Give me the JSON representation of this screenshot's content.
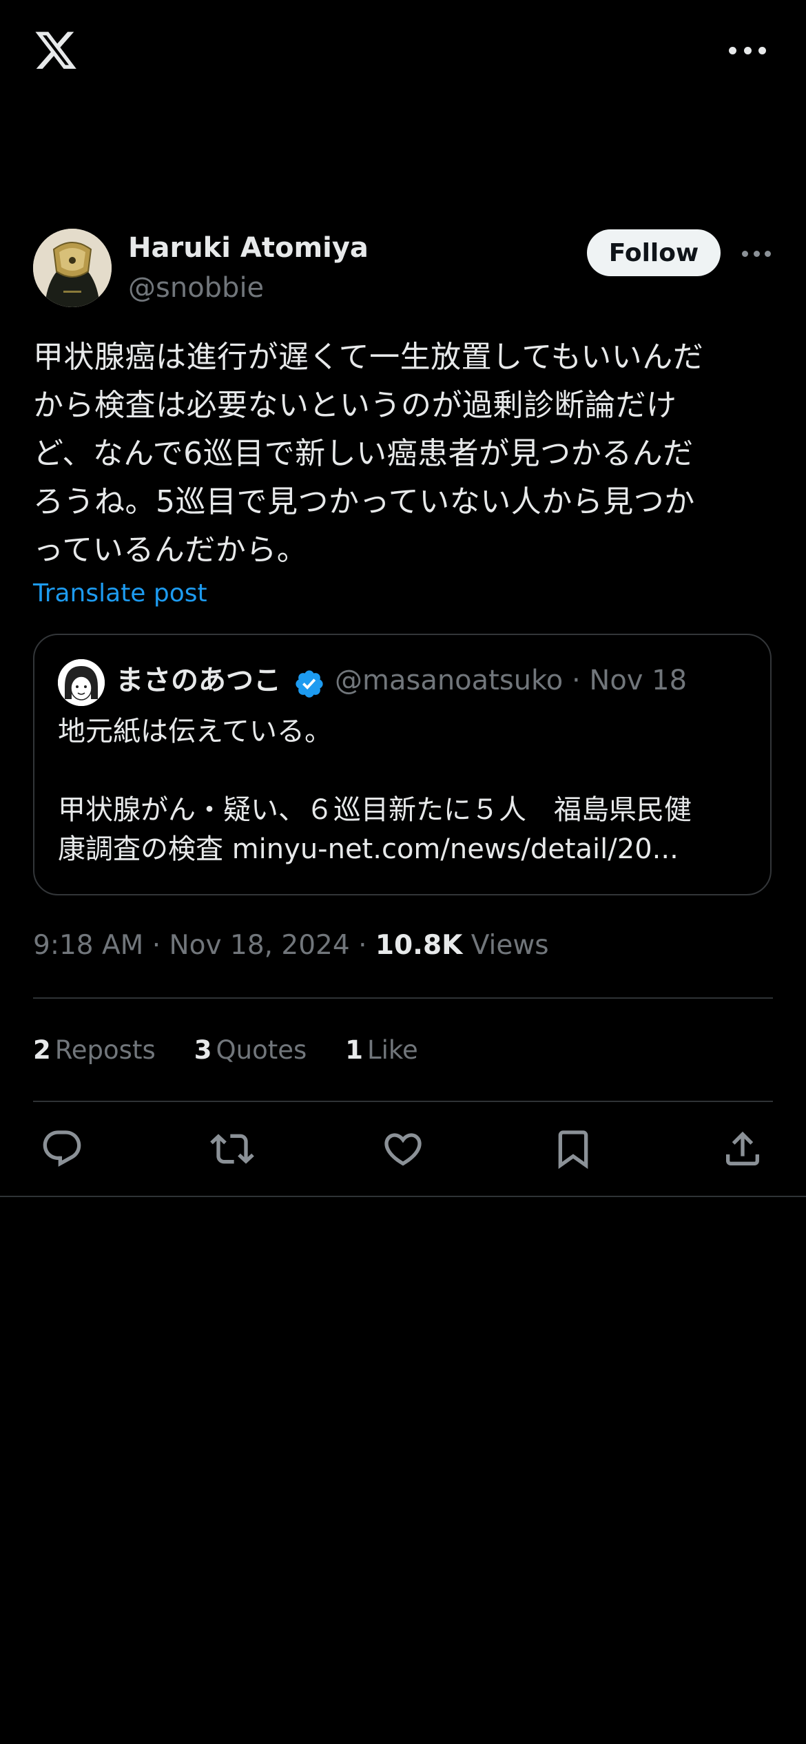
{
  "header": {
    "logo_icon": "x-logo-icon",
    "more_icon": "more-horizontal-icon"
  },
  "tweet": {
    "author": {
      "display_name": "Haruki Atomiya",
      "handle": "@snobbie",
      "avatar_icon": "avatar-image"
    },
    "follow_label": "Follow",
    "text": "甲状腺癌は進行が遅くて一生放置してもいいんだ\nから検査は必要ないというのが過剰診断論だけ\nど、なんで6巡目で新しい癌患者が見つかるんだ\nろうね。5巡目で見つかっていない人から見つか\nっているんだから。",
    "translate_label": "Translate post",
    "quote": {
      "display_name": "まさのあつこ",
      "verified_icon": "verified-badge-icon",
      "meta": "@masanoatsuko · Nov 18",
      "text": "地元紙は伝えている。\n\n甲状腺がん・疑い、６巡目新たに５人　福島県民健\n康調査の検査 minyu-net.com/news/detail/20..."
    },
    "timestamp": "9:18 AM · Nov 18, 2024 · ",
    "views_count": "10.8K",
    "views_label": " Views",
    "stats": {
      "reposts_count": "2",
      "reposts_label": "Reposts",
      "quotes_count": "3",
      "quotes_label": "Quotes",
      "likes_count": "1",
      "likes_label": "Like"
    }
  },
  "actions": [
    "reply-icon",
    "repost-icon",
    "like-icon",
    "bookmark-icon",
    "share-icon"
  ],
  "colors": {
    "background": "#000000",
    "text_primary": "#e7e9ea",
    "text_secondary": "#71767b",
    "accent": "#1d9bf0",
    "border": "#2f3336",
    "follow_bg": "#eff3f4"
  }
}
